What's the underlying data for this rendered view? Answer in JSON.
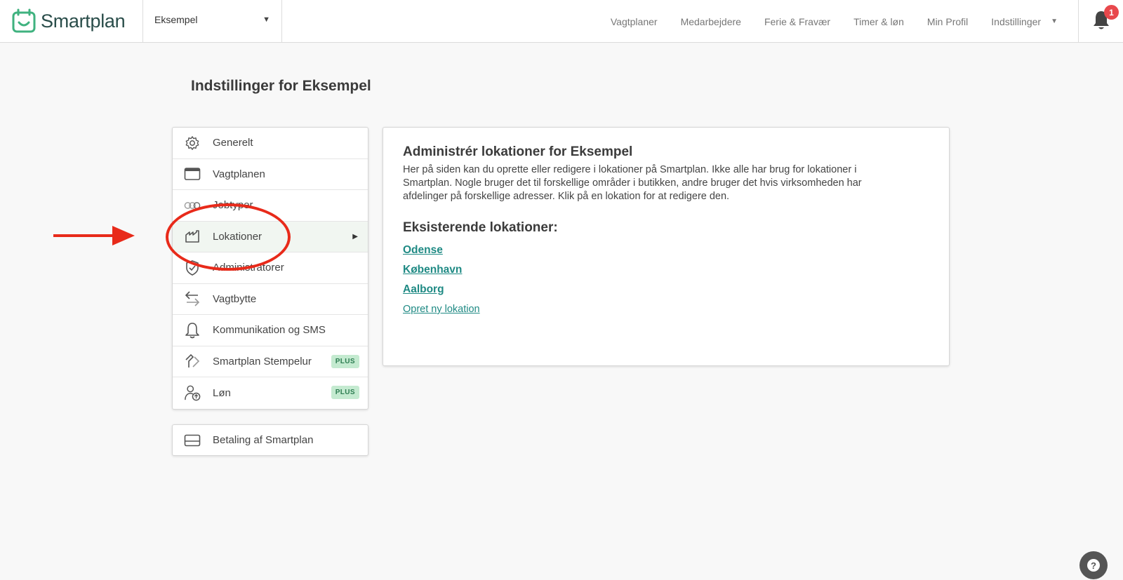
{
  "app": {
    "name": "Smartplan"
  },
  "company_select": {
    "value": "Eksempel"
  },
  "nav": {
    "items": [
      "Vagtplaner",
      "Medarbejdere",
      "Ferie & Fravær",
      "Timer & løn",
      "Min Profil",
      "Indstillinger"
    ],
    "notification_count": "1"
  },
  "page": {
    "title": "Indstillinger for Eksempel"
  },
  "menu": {
    "items": [
      {
        "label": "Generelt",
        "icon": "gear-icon"
      },
      {
        "label": "Vagtplanen",
        "icon": "calendar-icon"
      },
      {
        "label": "Jobtyper",
        "icon": "circles-icon"
      },
      {
        "label": "Lokationer",
        "icon": "building-icon",
        "active": true
      },
      {
        "label": "Administratorer",
        "icon": "shield-check-icon"
      },
      {
        "label": "Vagtbytte",
        "icon": "swap-arrows-icon"
      },
      {
        "label": "Kommunikation og SMS",
        "icon": "bell-icon"
      },
      {
        "label": "Smartplan Stempelur",
        "icon": "clock-in-icon",
        "badge": "PLUS"
      },
      {
        "label": "Løn",
        "icon": "user-upload-icon",
        "badge": "PLUS"
      }
    ],
    "payment": {
      "label": "Betaling af Smartplan",
      "icon": "credit-card-icon"
    }
  },
  "content": {
    "title": "Administrér lokationer for Eksempel",
    "description": "Her på siden kan du oprette eller redigere i lokationer på Smartplan. Ikke alle har brug for lokationer i Smartplan. Nogle bruger det til forskellige områder i butikken, andre bruger det hvis virksomheden har afdelinger på forskellige adresser. Klik på en lokation for at redigere den.",
    "existing_heading": "Eksisterende lokationer:",
    "locations": [
      "Odense",
      "København",
      "Aalborg"
    ],
    "create_link": "Opret ny lokation"
  },
  "colors": {
    "accent": "#1f8a84",
    "annotation": "#e82a1a",
    "plus_badge_bg": "#c4ead0",
    "notification": "#e8484c"
  }
}
